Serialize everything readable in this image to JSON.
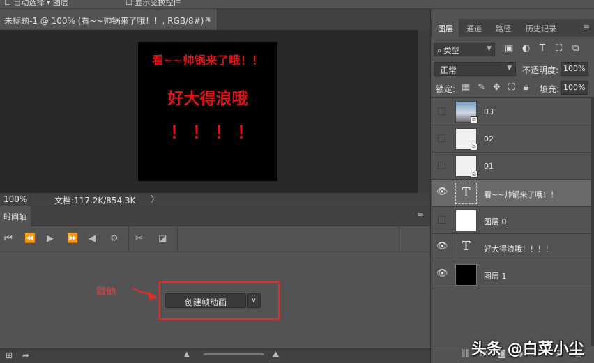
{
  "document": {
    "tab_title": "未标题-1 @ 100% (看~~帅锅来了哦！！, RGB/8#) *",
    "close_glyph": "×",
    "canvas_text": {
      "line1": "看~~帅锅来了哦！！",
      "line2": "好大得浪哦",
      "line3": "！！！！",
      "color": "#e01414"
    }
  },
  "statusbar": {
    "zoom": "100%",
    "doc_info": "文档:117.2K/854.3K",
    "arrow": "〉"
  },
  "timeline": {
    "title": "时间轴",
    "menu_glyph": "≡",
    "create_button_label": "创建帧动画",
    "dropdown_glyph": "∨",
    "annotation": "戳他",
    "annotation_color": "#e84040",
    "highlight_color": "#e02c2c",
    "controls": [
      "first-frame-icon",
      "prev-frame-icon",
      "play-icon",
      "next-frame-icon",
      "audio-icon",
      "settings-icon",
      "scissors-icon",
      "transition-icon"
    ]
  },
  "layers_panel": {
    "tabs": [
      "图层",
      "通道",
      "路径",
      "历史记录"
    ],
    "active_tab": "图层",
    "filter_label": "类型",
    "blend_mode": "正常",
    "opacity_label": "不透明度:",
    "opacity_value": "100%",
    "lock_label": "锁定:",
    "fill_label": "填充:",
    "fill_value": "100%",
    "layers": [
      {
        "name": "03",
        "visible": false,
        "thumb": "photo",
        "smart_object": true,
        "selected": false
      },
      {
        "name": "02",
        "visible": false,
        "thumb": "sketch",
        "smart_object": true,
        "selected": false
      },
      {
        "name": "01",
        "visible": false,
        "thumb": "sketch",
        "smart_object": true,
        "selected": false
      },
      {
        "name": "看~~帅锅来了哦！！",
        "visible": true,
        "thumb": "text",
        "smart_object": false,
        "selected": true
      },
      {
        "name": "图层 0",
        "visible": false,
        "thumb": "white",
        "smart_object": false,
        "selected": false
      },
      {
        "name": "好大得浪哦！！！！",
        "visible": true,
        "thumb": "text",
        "smart_object": false,
        "selected": false
      },
      {
        "name": "图层 1",
        "visible": true,
        "thumb": "black",
        "smart_object": false,
        "selected": false
      }
    ]
  },
  "watermark": "头条 @白菜小尘"
}
